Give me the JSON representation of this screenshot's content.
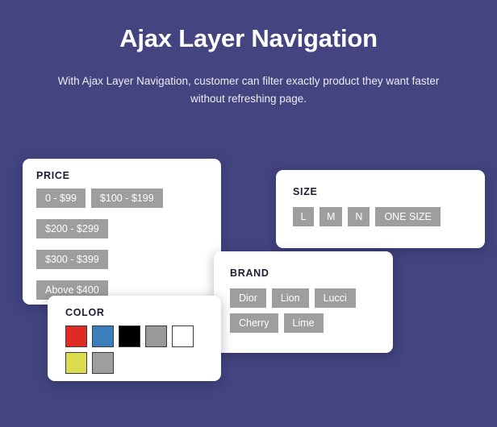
{
  "theme": {
    "background": "#434480",
    "card_background": "#ffffff",
    "pill_background": "#9e9e9e",
    "pill_text": "#ffffff",
    "heading_text": "#1d1d33",
    "title_text": "#ffffff"
  },
  "header": {
    "title": "Ajax Layer Navigation",
    "subtitle": "With Ajax Layer Navigation, customer can filter exactly product they want faster without refreshing page."
  },
  "filters": {
    "price": {
      "title": "PRICE",
      "options": [
        {
          "label": "0 - $99"
        },
        {
          "label": "$100 - $199"
        },
        {
          "label": "$200 - $299"
        },
        {
          "label": "$300 - $399"
        },
        {
          "label": "Above $400"
        }
      ]
    },
    "size": {
      "title": "SIZE",
      "options": [
        {
          "label": "L"
        },
        {
          "label": "M"
        },
        {
          "label": "N"
        },
        {
          "label": "ONE SIZE"
        }
      ]
    },
    "brand": {
      "title": "BRAND",
      "options": [
        {
          "label": "Dior"
        },
        {
          "label": "Lion"
        },
        {
          "label": "Lucci"
        },
        {
          "label": "Cherry"
        },
        {
          "label": "Lime"
        }
      ]
    },
    "color": {
      "title": "COLOR",
      "options": [
        {
          "name": "red",
          "hex": "#e02b25"
        },
        {
          "name": "blue",
          "hex": "#3b7ebc"
        },
        {
          "name": "black",
          "hex": "#000000"
        },
        {
          "name": "gray",
          "hex": "#999999"
        },
        {
          "name": "white",
          "hex": "#ffffff"
        },
        {
          "name": "yellow",
          "hex": "#dbdb4e"
        },
        {
          "name": "silver",
          "hex": "#9e9e9e"
        }
      ]
    }
  }
}
